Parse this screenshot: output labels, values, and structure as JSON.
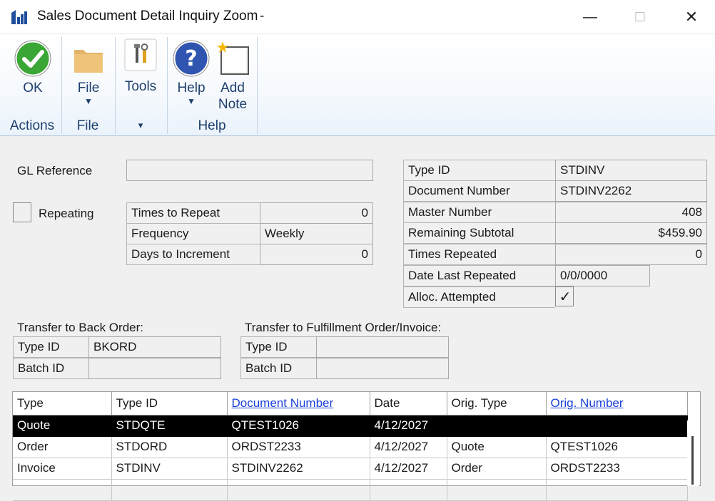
{
  "window": {
    "title": "Sales Document Detail Inquiry Zoom",
    "title_suffix": "-",
    "min_glyph": "—",
    "max_glyph": "☐",
    "close_glyph": "✕"
  },
  "ribbon": {
    "ok": {
      "label": "OK",
      "icon": "green-check-icon"
    },
    "file": {
      "label": "File",
      "icon": "folder-icon"
    },
    "tools": {
      "label": "Tools",
      "icon": "tools-icon"
    },
    "help": {
      "label": "Help",
      "icon": "help-icon"
    },
    "add_note": {
      "label_line1": "Add",
      "label_line2": "Note",
      "icon": "add-note-icon"
    },
    "groups": {
      "actions": "Actions",
      "file": "File",
      "tools_arrow": "▾",
      "help": "Help"
    },
    "dropdown_arrow": "▼"
  },
  "form": {
    "gl_reference": {
      "label": "GL Reference",
      "value": ""
    },
    "repeating": {
      "label": "Repeating",
      "checked": false
    },
    "times_to_repeat": {
      "label": "Times to Repeat",
      "value": "0"
    },
    "frequency": {
      "label": "Frequency",
      "value": "Weekly"
    },
    "days_to_increment": {
      "label": "Days to Increment",
      "value": "0"
    },
    "type_id": {
      "label": "Type ID",
      "value": "STDINV"
    },
    "document_number": {
      "label": "Document Number",
      "value": "STDINV2262"
    },
    "master_number": {
      "label": "Master Number",
      "value": "408"
    },
    "remaining_subtotal": {
      "label": "Remaining Subtotal",
      "value": "$459.90"
    },
    "times_repeated": {
      "label": "Times Repeated",
      "value": "0"
    },
    "date_last_repeated": {
      "label": "Date Last Repeated",
      "value": "0/0/0000"
    },
    "alloc_attempted": {
      "label": "Alloc. Attempted",
      "mark": "✓"
    }
  },
  "back_order": {
    "heading": "Transfer to Back Order:",
    "type_id_label": "Type ID",
    "type_id_value": "BKORD",
    "batch_id_label": "Batch ID",
    "batch_id_value": ""
  },
  "fulfillment": {
    "heading": "Transfer to Fulfillment Order/Invoice:",
    "type_id_label": "Type ID",
    "type_id_value": "",
    "batch_id_label": "Batch ID",
    "batch_id_value": ""
  },
  "grid": {
    "columns": [
      "Type",
      "Type ID",
      "Document Number",
      "Date",
      "Orig. Type",
      "Orig. Number"
    ],
    "rows": [
      [
        "Quote",
        "STDQTE",
        "QTEST1026",
        "4/12/2027",
        "",
        ""
      ],
      [
        "Order",
        "STDORD",
        "ORDST2233",
        "4/12/2027",
        "Quote",
        "QTEST1026"
      ],
      [
        "Invoice",
        "STDINV",
        "STDINV2262",
        "4/12/2027",
        "Order",
        "ORDST2233"
      ],
      [
        "",
        "",
        "",
        "",
        "",
        ""
      ]
    ]
  },
  "colors": {
    "ribbon_text": "#1e3f6e",
    "link": "#1a3fd9",
    "selected_row": "#000000"
  }
}
